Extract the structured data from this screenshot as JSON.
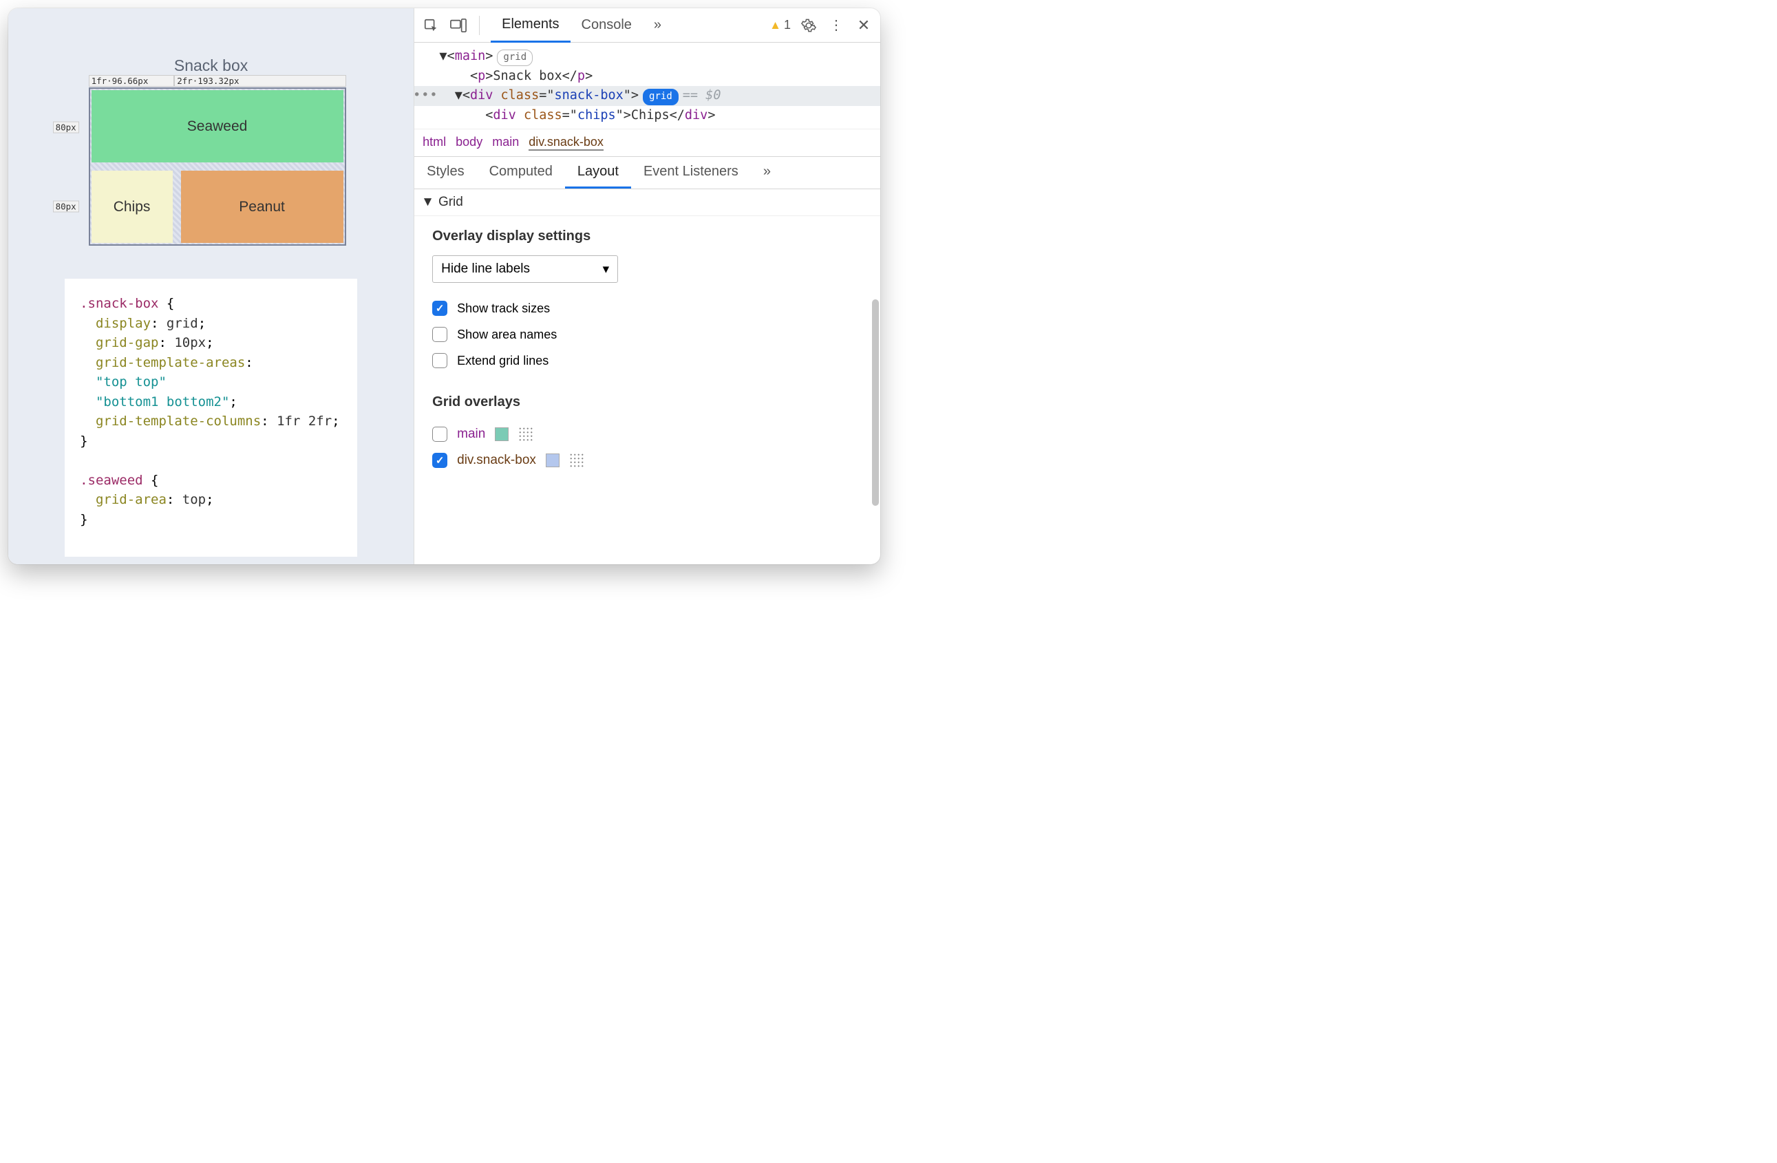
{
  "preview": {
    "title": "Snack box",
    "col1_label": "1fr·96.66px",
    "col2_label": "2fr·193.32px",
    "row1_label": "80px",
    "row2_label": "80px",
    "cells": {
      "seaweed": "Seaweed",
      "chips": "Chips",
      "peanut": "Peanut"
    }
  },
  "css_code": {
    "sel1": ".snack-box",
    "p1": "display",
    "v1": "grid",
    "p2": "grid-gap",
    "v2": "10px",
    "p3": "grid-template-areas",
    "s1": "\"top top\"",
    "s2": "\"bottom1 bottom2\"",
    "p4": "grid-template-columns",
    "v4": "1fr 2fr",
    "sel2": ".seaweed",
    "p5": "grid-area",
    "v5": "top"
  },
  "devtools": {
    "tabs": {
      "elements": "Elements",
      "console": "Console"
    },
    "warnings_count": "1",
    "dom": {
      "l1_tag": "main",
      "l1_badge": "grid",
      "l2_tag": "p",
      "l2_text": "Snack box",
      "l3_tag": "div",
      "l3_attr": "class",
      "l3_val": "snack-box",
      "l3_badge": "grid",
      "l3_suffix": "== $0",
      "l4_tag": "div",
      "l4_attr": "class",
      "l4_val": "chips",
      "l4_text": "Chips"
    },
    "breadcrumbs": {
      "html": "html",
      "body": "body",
      "main": "main",
      "current": "div.snack-box"
    },
    "subtabs": {
      "styles": "Styles",
      "computed": "Computed",
      "layout": "Layout",
      "events": "Event Listeners"
    },
    "grid_section": "Grid",
    "overlay_heading": "Overlay display settings",
    "dropdown_label": "Hide line labels",
    "opt_track_sizes": "Show track sizes",
    "opt_area_names": "Show area names",
    "opt_extend_lines": "Extend grid lines",
    "overlays_heading": "Grid overlays",
    "overlay_main": "main",
    "overlay_snackbox": "div.snack-box",
    "swatch_main": "#7bcbb5",
    "swatch_snackbox": "#b4c7ed"
  }
}
